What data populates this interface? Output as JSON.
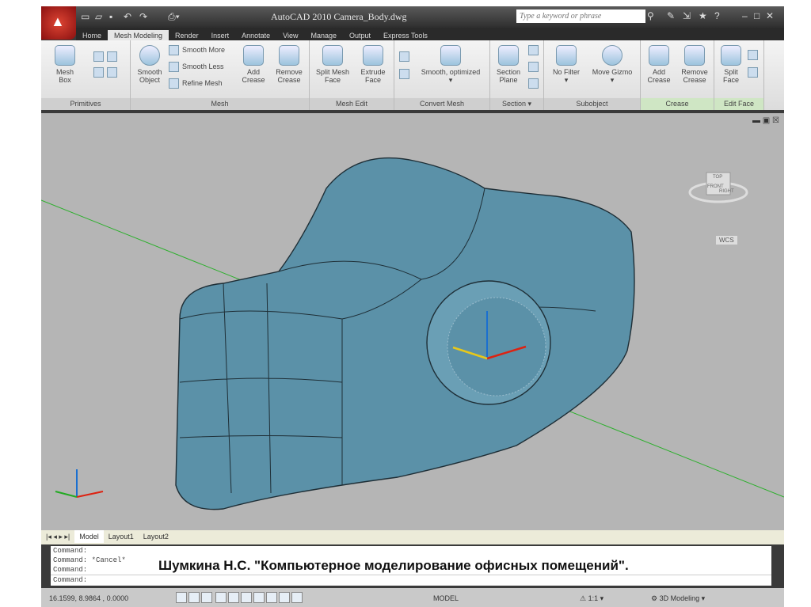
{
  "window": {
    "title": "AutoCAD 2010   Camera_Body.dwg",
    "search_placeholder": "Type a keyword or phrase"
  },
  "tabs": [
    "Home",
    "Mesh Modeling",
    "Render",
    "Insert",
    "Annotate",
    "View",
    "Manage",
    "Output",
    "Express Tools"
  ],
  "active_tab": "Mesh Modeling",
  "ribbon": {
    "primitives": {
      "label": "Primitives",
      "mesh_box": "Mesh Box"
    },
    "mesh": {
      "label": "Mesh",
      "smooth_object": "Smooth Object",
      "smooth_more": "Smooth More",
      "smooth_less": "Smooth Less",
      "refine_mesh": "Refine Mesh"
    },
    "crease1": {
      "add": "Add Crease",
      "remove": "Remove Crease"
    },
    "mesh_edit": {
      "label": "Mesh Edit",
      "split": "Split Mesh Face",
      "extrude": "Extrude Face"
    },
    "convert": {
      "label": "Convert Mesh",
      "smooth_optimized": "Smooth, optimized"
    },
    "section": {
      "label": "Section",
      "plane": "Section Plane"
    },
    "subobject": {
      "label": "Subobject",
      "no_filter": "No Filter",
      "move_gizmo": "Move Gizmo"
    },
    "crease": {
      "label": "Crease",
      "add": "Add Crease",
      "remove": "Remove Crease"
    },
    "edit_face": {
      "label": "Edit Face",
      "split": "Split Face"
    }
  },
  "viewcube": {
    "wcs": "WCS",
    "faces": [
      "TOP",
      "FRONT",
      "RIGHT"
    ]
  },
  "layout_tabs": [
    "Model",
    "Layout1",
    "Layout2"
  ],
  "command_lines": [
    "Command:",
    "Command:  *Cancel*",
    "Command:",
    "Command:"
  ],
  "watermark": "Шумкина Н.С. \"Компьютерное моделирование офисных помещений\".",
  "status": {
    "coords": "16.1599, 8.9864 , 0.0000",
    "model": "MODEL",
    "scale": "1:1",
    "workspace": "3D Modeling"
  },
  "colors": {
    "mesh": "#5b91a8",
    "viewport": "#b5b5b5"
  }
}
